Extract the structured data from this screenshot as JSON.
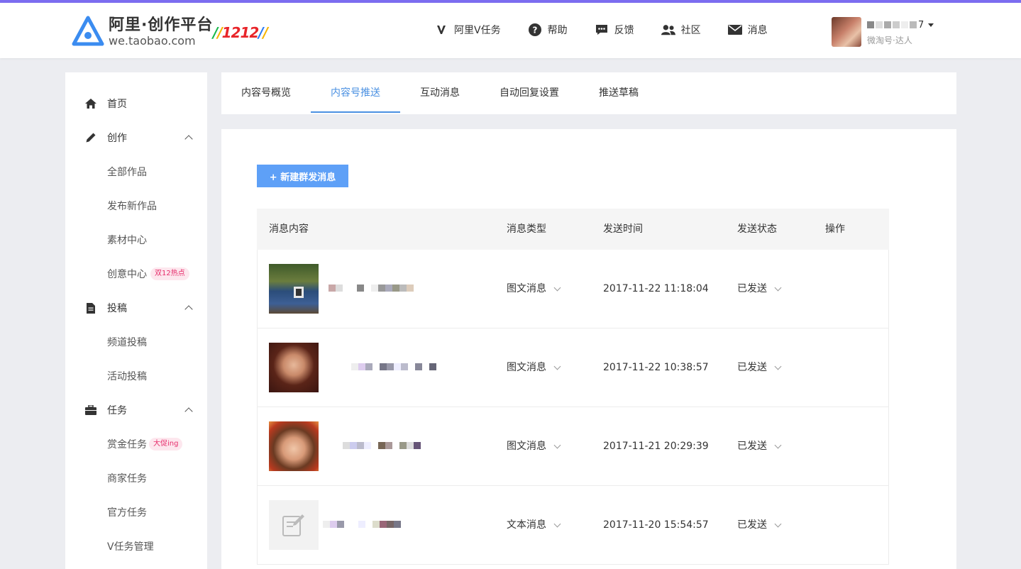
{
  "header": {
    "logo_cn": "阿里·创作平台",
    "logo_en": "we.taobao.com",
    "promo": "1212",
    "nav": [
      {
        "icon": "v-icon",
        "label": "阿里V任务"
      },
      {
        "icon": "help-icon",
        "label": "帮助"
      },
      {
        "icon": "feedback-icon",
        "label": "反馈"
      },
      {
        "icon": "community-icon",
        "label": "社区"
      },
      {
        "icon": "mail-icon",
        "label": "消息"
      }
    ],
    "user": {
      "name_suffix": "7",
      "subtitle": "微淘号·达人"
    }
  },
  "sidebar": {
    "items": [
      {
        "label": "首页",
        "icon": "home-icon"
      },
      {
        "label": "创作",
        "icon": "pencil-icon"
      },
      {
        "label": "全部作品"
      },
      {
        "label": "发布新作品"
      },
      {
        "label": "素材中心"
      },
      {
        "label": "创意中心",
        "badge": "双12热点"
      },
      {
        "label": "投稿",
        "icon": "document-icon"
      },
      {
        "label": "频道投稿"
      },
      {
        "label": "活动投稿"
      },
      {
        "label": "任务",
        "icon": "briefcase-icon"
      },
      {
        "label": "赏金任务",
        "badge": "大促ing"
      },
      {
        "label": "商家任务"
      },
      {
        "label": "官方任务"
      },
      {
        "label": "V任务管理"
      }
    ]
  },
  "tabs": [
    "内容号概览",
    "内容号推送",
    "互动消息",
    "自动回复设置",
    "推送草稿"
  ],
  "active_tab": "内容号推送",
  "new_button": "+ 新建群发消息",
  "table": {
    "headers": [
      "消息内容",
      "消息类型",
      "发送时间",
      "发送状态",
      "操作"
    ],
    "rows": [
      {
        "type": "图文消息",
        "time": "2017-11-22 11:18:04",
        "status": "已发送"
      },
      {
        "type": "图文消息",
        "time": "2017-11-22 10:38:57",
        "status": "已发送"
      },
      {
        "type": "图文消息",
        "time": "2017-11-21 20:29:39",
        "status": "已发送"
      },
      {
        "type": "文本消息",
        "time": "2017-11-20 15:54:57",
        "status": "已发送"
      }
    ]
  },
  "colors": {
    "accent": "#4a90e2",
    "button": "#5ea0f7",
    "topline": "#7c6df0",
    "badge_text": "#e62d6b"
  }
}
